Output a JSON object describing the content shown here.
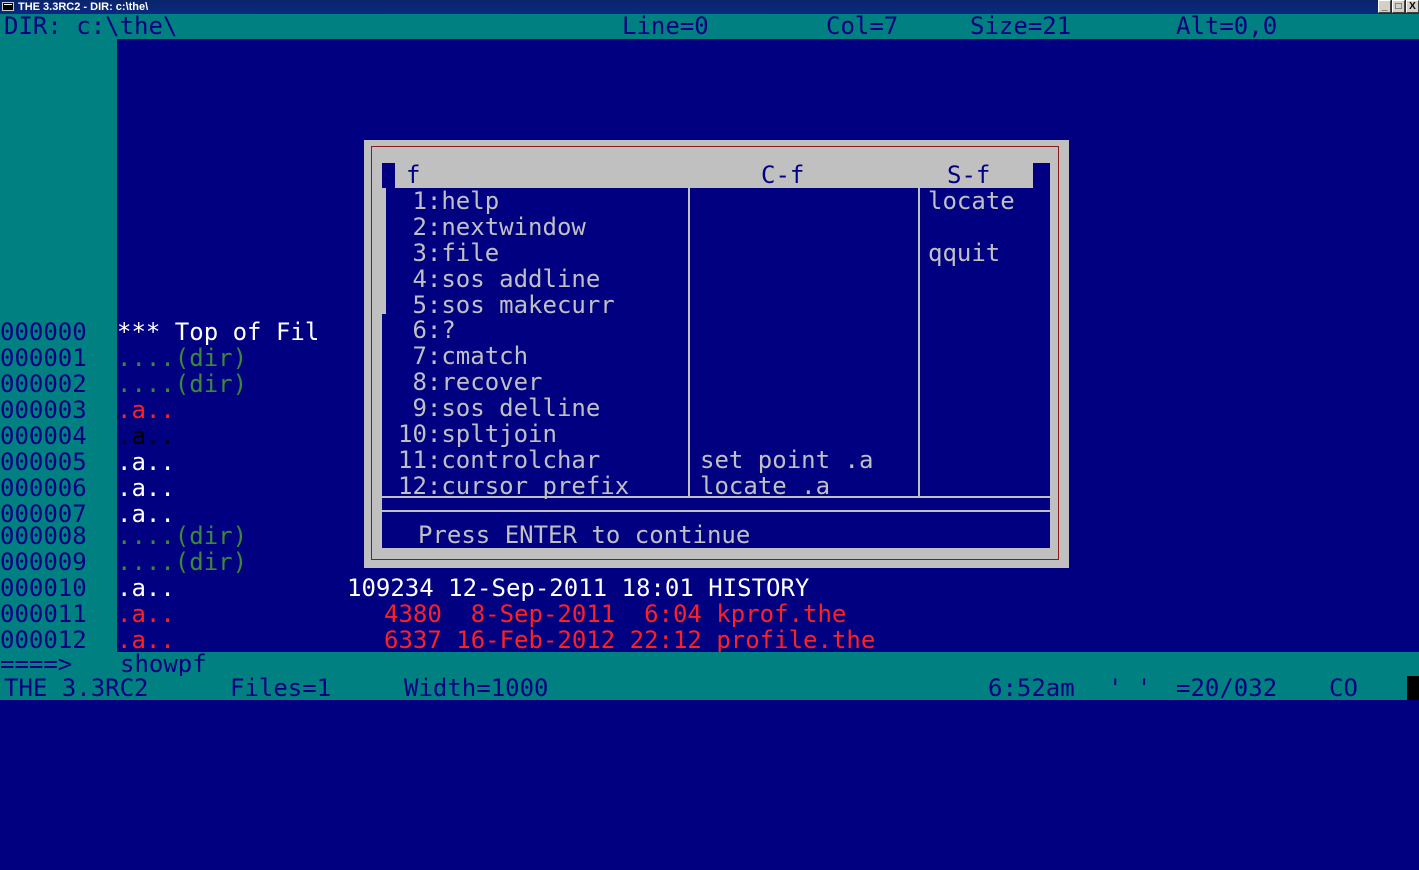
{
  "window": {
    "title": "THE 3.3RC2 - DIR: c:\\the\\",
    "buttons": {
      "minimize": "_",
      "maximize": "□",
      "close": "X"
    }
  },
  "status": {
    "dir": "DIR: c:\\the\\",
    "line": "Line=0",
    "col": "Col=7",
    "size": "Size=21",
    "alt": "Alt=0,0"
  },
  "lines": [
    {
      "prefix": "000000",
      "text": "*** Top of Fil",
      "color": "#ffffff"
    },
    {
      "prefix": "000001",
      "text": "....(dir)",
      "color": "#3a8a3a"
    },
    {
      "prefix": "000002",
      "text": "....(dir)",
      "color": "#3a8a3a"
    },
    {
      "prefix": "000003",
      "text": ".a..",
      "color": "#ff2020"
    },
    {
      "prefix": "000004",
      "text": ".a..",
      "color": "#000000"
    },
    {
      "prefix": "000005",
      "text": ".a..",
      "color": "#ffffff"
    },
    {
      "prefix": "000006",
      "text": ".a..",
      "color": "#ffffff"
    },
    {
      "prefix": "000007",
      "text": ".a..",
      "color": "#ffffff"
    },
    {
      "prefix": "000008",
      "text": "....(dir)",
      "color": "#3a8a3a"
    },
    {
      "prefix": "000009",
      "text": "....(dir)",
      "color": "#3a8a3a"
    },
    {
      "prefix": "000010",
      "text": ".a..",
      "color": "#ffffff",
      "rest": "109234 12-Sep-2011 18:01 HISTORY"
    },
    {
      "prefix": "000011",
      "text": ".a..",
      "color": "#ff2020",
      "rest": "4380  8-Sep-2011  6:04 kprof.the"
    },
    {
      "prefix": "000012",
      "text": ".a..",
      "color": "#ff2020",
      "rest": "6337 16-Feb-2012 22:12 profile.the"
    }
  ],
  "command_line": {
    "arrow": "====>",
    "value": "showpf"
  },
  "bottom": {
    "app": "THE 3.3RC2",
    "files": "Files=1",
    "width": "Width=1000",
    "time": "6:52am",
    "quote": "' '",
    "position": "=20/032",
    "mode": "CO"
  },
  "dialog": {
    "headers": [
      "f",
      "C-f",
      "S-f"
    ],
    "rows": [
      {
        "f": " 1:help",
        "cf": "",
        "sf": "locate"
      },
      {
        "f": " 2:nextwindow",
        "cf": "",
        "sf": ""
      },
      {
        "f": " 3:file",
        "cf": "",
        "sf": "qquit"
      },
      {
        "f": " 4:sos addline",
        "cf": "",
        "sf": ""
      },
      {
        "f": " 5:sos makecurr",
        "cf": "",
        "sf": ""
      },
      {
        "f": " 6:?",
        "cf": "",
        "sf": ""
      },
      {
        "f": " 7:cmatch",
        "cf": "",
        "sf": ""
      },
      {
        "f": " 8:recover",
        "cf": "",
        "sf": ""
      },
      {
        "f": " 9:sos delline",
        "cf": "",
        "sf": ""
      },
      {
        "f": "10:spltjoin",
        "cf": "",
        "sf": ""
      },
      {
        "f": "11:controlchar",
        "cf": "set point .a",
        "sf": ""
      },
      {
        "f": "12:cursor prefix",
        "cf": "locate .a",
        "sf": ""
      }
    ],
    "prompt": "Press ENTER to continue"
  }
}
